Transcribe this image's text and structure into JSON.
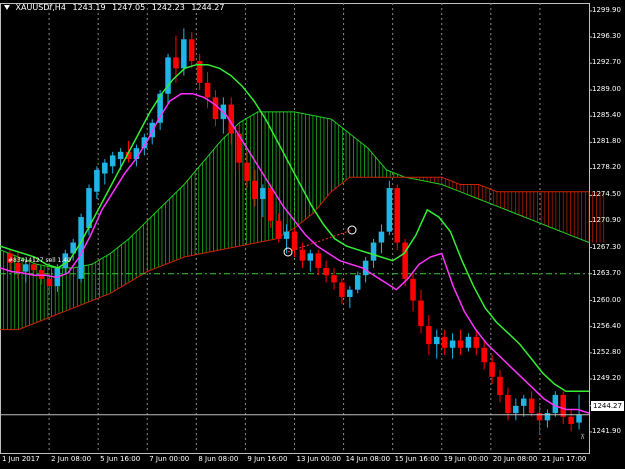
{
  "chart_info": {
    "symbol": "XAUUSDf,H4",
    "open": "1243.19",
    "high": "1247.05",
    "low": "1242.23",
    "close": "1244.27"
  },
  "trade_label": "#83414127 sell 1.40",
  "current_price": "1244.27",
  "chart_data": {
    "type": "candlestick",
    "price_axis": {
      "min": 1239.0,
      "max": 1301.0,
      "labels": [
        "1299.90",
        "1296.30",
        "1292.70",
        "1289.00",
        "1285.40",
        "1281.80",
        "1278.20",
        "1274.50",
        "1270.90",
        "1267.30",
        "1263.70",
        "1260.00",
        "1256.40",
        "1252.80",
        "1249.20",
        "1245.50",
        "1241.90"
      ]
    },
    "time_axis": {
      "labels": [
        "1 Jun 2017",
        "2 Jun 08:00",
        "5 Jun 16:00",
        "7 Jun 00:00",
        "8 Jun 08:00",
        "9 Jun 16:00",
        "13 Jun 00:00",
        "14 Jun 08:00",
        "15 Jun 16:00",
        "19 Jun 00:00",
        "20 Jun 08:00",
        "21 Jun 17:00"
      ]
    },
    "grid": false,
    "period_separators": true,
    "horizontal_level": 1263.7,
    "colors": {
      "bull": "#1fb6e6",
      "bear": "#ff0000",
      "ma_fast": "#ff33ff",
      "ma_slow": "#33ee33",
      "cloud_up": "#22cc22",
      "cloud_down": "#cc2200"
    },
    "candles": [
      [
        1266.5,
        1267.2,
        1264.1,
        1265.2
      ],
      [
        1265.2,
        1266.8,
        1263.0,
        1264.0
      ],
      [
        1264.0,
        1265.5,
        1262.5,
        1265.0
      ],
      [
        1265.0,
        1266.0,
        1263.3,
        1264.2
      ],
      [
        1264.2,
        1265.0,
        1262.2,
        1263.0
      ],
      [
        1263.0,
        1263.8,
        1261.0,
        1262.0
      ],
      [
        1262.0,
        1265.0,
        1261.2,
        1264.5
      ],
      [
        1264.5,
        1267.0,
        1263.8,
        1266.5
      ],
      [
        1266.5,
        1268.5,
        1265.5,
        1268.0
      ],
      [
        1263.0,
        1272.0,
        1262.5,
        1271.5
      ],
      [
        1270.0,
        1276.0,
        1269.0,
        1275.5
      ],
      [
        1275.0,
        1278.5,
        1274.0,
        1278.0
      ],
      [
        1277.5,
        1279.5,
        1276.0,
        1279.0
      ],
      [
        1278.5,
        1280.5,
        1277.5,
        1280.0
      ],
      [
        1279.5,
        1281.0,
        1278.0,
        1280.5
      ],
      [
        1280.5,
        1282.0,
        1279.0,
        1279.5
      ],
      [
        1279.5,
        1281.5,
        1278.5,
        1281.0
      ],
      [
        1281.0,
        1283.0,
        1280.0,
        1282.5
      ],
      [
        1282.5,
        1285.0,
        1281.5,
        1284.5
      ],
      [
        1284.5,
        1289.0,
        1283.5,
        1288.5
      ],
      [
        1288.5,
        1294.0,
        1287.0,
        1293.5
      ],
      [
        1293.5,
        1296.5,
        1290.0,
        1292.0
      ],
      [
        1292.0,
        1297.5,
        1291.0,
        1296.0
      ],
      [
        1296.0,
        1297.0,
        1292.0,
        1293.0
      ],
      [
        1293.0,
        1294.0,
        1289.0,
        1290.0
      ],
      [
        1290.0,
        1291.5,
        1286.5,
        1288.0
      ],
      [
        1288.0,
        1289.0,
        1284.0,
        1285.0
      ],
      [
        1285.0,
        1288.0,
        1283.0,
        1287.0
      ],
      [
        1287.0,
        1288.0,
        1281.5,
        1283.0
      ],
      [
        1283.0,
        1284.0,
        1278.0,
        1279.0
      ],
      [
        1279.0,
        1280.5,
        1275.5,
        1276.5
      ],
      [
        1276.5,
        1278.0,
        1273.0,
        1274.0
      ],
      [
        1274.0,
        1276.0,
        1271.5,
        1275.5
      ],
      [
        1275.5,
        1276.0,
        1270.0,
        1271.0
      ],
      [
        1271.0,
        1272.0,
        1268.0,
        1268.5
      ],
      [
        1268.5,
        1270.5,
        1266.5,
        1269.5
      ],
      [
        1269.5,
        1270.0,
        1266.0,
        1267.0
      ],
      [
        1267.0,
        1268.0,
        1264.5,
        1265.5
      ],
      [
        1265.5,
        1267.0,
        1264.0,
        1266.5
      ],
      [
        1266.5,
        1267.0,
        1263.5,
        1264.5
      ],
      [
        1264.5,
        1265.5,
        1262.5,
        1263.5
      ],
      [
        1263.5,
        1264.5,
        1261.5,
        1262.5
      ],
      [
        1262.5,
        1263.0,
        1259.5,
        1260.5
      ],
      [
        1260.5,
        1262.0,
        1259.0,
        1261.5
      ],
      [
        1261.5,
        1264.0,
        1261.0,
        1263.5
      ],
      [
        1263.5,
        1266.0,
        1262.5,
        1265.5
      ],
      [
        1265.5,
        1268.5,
        1264.5,
        1268.0
      ],
      [
        1268.0,
        1270.5,
        1266.5,
        1269.5
      ],
      [
        1269.5,
        1276.5,
        1269.0,
        1275.5
      ],
      [
        1275.5,
        1276.0,
        1267.0,
        1268.0
      ],
      [
        1268.0,
        1268.5,
        1262.0,
        1263.0
      ],
      [
        1263.0,
        1264.0,
        1258.5,
        1260.0
      ],
      [
        1260.0,
        1261.5,
        1255.5,
        1256.5
      ],
      [
        1256.5,
        1258.0,
        1252.5,
        1254.0
      ],
      [
        1254.0,
        1256.0,
        1252.0,
        1255.0
      ],
      [
        1255.0,
        1256.0,
        1252.5,
        1253.5
      ],
      [
        1253.5,
        1255.5,
        1252.0,
        1254.5
      ],
      [
        1254.5,
        1256.0,
        1252.5,
        1253.5
      ],
      [
        1253.5,
        1255.5,
        1253.0,
        1255.0
      ],
      [
        1255.0,
        1256.0,
        1252.5,
        1253.5
      ],
      [
        1253.5,
        1254.5,
        1250.5,
        1251.5
      ],
      [
        1251.5,
        1252.5,
        1248.5,
        1249.5
      ],
      [
        1249.5,
        1250.5,
        1246.0,
        1247.0
      ],
      [
        1247.0,
        1248.0,
        1243.5,
        1244.5
      ],
      [
        1244.5,
        1246.5,
        1243.5,
        1245.5
      ],
      [
        1245.5,
        1247.0,
        1244.0,
        1246.5
      ],
      [
        1246.5,
        1247.5,
        1244.0,
        1244.5
      ],
      [
        1244.5,
        1245.5,
        1241.5,
        1243.5
      ],
      [
        1243.5,
        1245.0,
        1242.5,
        1244.5
      ],
      [
        1244.5,
        1247.5,
        1244.0,
        1247.0
      ],
      [
        1247.0,
        1247.5,
        1243.0,
        1244.0
      ],
      [
        1244.0,
        1245.0,
        1242.0,
        1243.0
      ],
      [
        1243.19,
        1247.05,
        1242.23,
        1244.27
      ]
    ],
    "ma_fast": [
      1264.5,
      1264.0,
      1263.8,
      1263.5,
      1263.5,
      1263.2,
      1263.8,
      1266.0,
      1269.0,
      1272.5,
      1275.0,
      1277.5,
      1279.5,
      1282.0,
      1285.0,
      1287.5,
      1288.5,
      1288.5,
      1288.0,
      1287.0,
      1285.5,
      1283.0,
      1280.5,
      1278.0,
      1275.5,
      1273.0,
      1271.0,
      1269.0,
      1267.5,
      1266.5,
      1265.5,
      1265.0,
      1264.5,
      1263.5,
      1262.5,
      1261.5,
      1263.0,
      1265.0,
      1266.0,
      1266.5,
      1262.0,
      1258.5,
      1256.0,
      1254.0,
      1252.5,
      1251.0,
      1249.5,
      1248.0,
      1246.5,
      1245.5,
      1245.0,
      1245.0,
      1244.5
    ],
    "ma_slow": [
      1267.5,
      1267.0,
      1266.5,
      1266.0,
      1265.0,
      1264.5,
      1265.5,
      1268.0,
      1271.0,
      1274.0,
      1277.0,
      1280.0,
      1283.0,
      1286.0,
      1288.5,
      1290.5,
      1292.0,
      1292.5,
      1292.5,
      1292.0,
      1291.0,
      1289.5,
      1287.5,
      1285.0,
      1282.0,
      1279.0,
      1276.0,
      1273.0,
      1270.5,
      1268.5,
      1267.5,
      1267.0,
      1266.5,
      1266.0,
      1265.5,
      1266.5,
      1269.0,
      1272.5,
      1271.5,
      1269.5,
      1265.5,
      1262.0,
      1259.0,
      1257.0,
      1255.5,
      1254.0,
      1252.0,
      1250.0,
      1248.5,
      1247.5,
      1247.5,
      1247.5
    ],
    "span_a": [
      1267.0,
      1266.0,
      1265.0,
      1264.5,
      1264.5,
      1265.0,
      1266.5,
      1268.5,
      1271.0,
      1273.5,
      1276.0,
      1279.0,
      1282.0,
      1284.5,
      1286.0,
      1286.0,
      1286.0,
      1285.5,
      1285.0,
      1283.0,
      1281.0,
      1278.0,
      1277.0,
      1276.5,
      1276.0,
      1275.0,
      1274.0,
      1273.0,
      1272.0,
      1271.0,
      1270.0,
      1269.0,
      1268.0
    ],
    "span_b": [
      1256.0,
      1256.0,
      1257.0,
      1258.0,
      1259.0,
      1260.0,
      1261.0,
      1262.5,
      1264.0,
      1265.0,
      1266.0,
      1266.5,
      1267.0,
      1267.5,
      1268.0,
      1268.5,
      1270.0,
      1272.0,
      1275.0,
      1277.0,
      1277.0,
      1277.0,
      1277.0,
      1277.0,
      1277.0,
      1276.0,
      1276.0,
      1275.0,
      1275.0,
      1275.0,
      1275.0,
      1275.0,
      1275.0
    ]
  }
}
